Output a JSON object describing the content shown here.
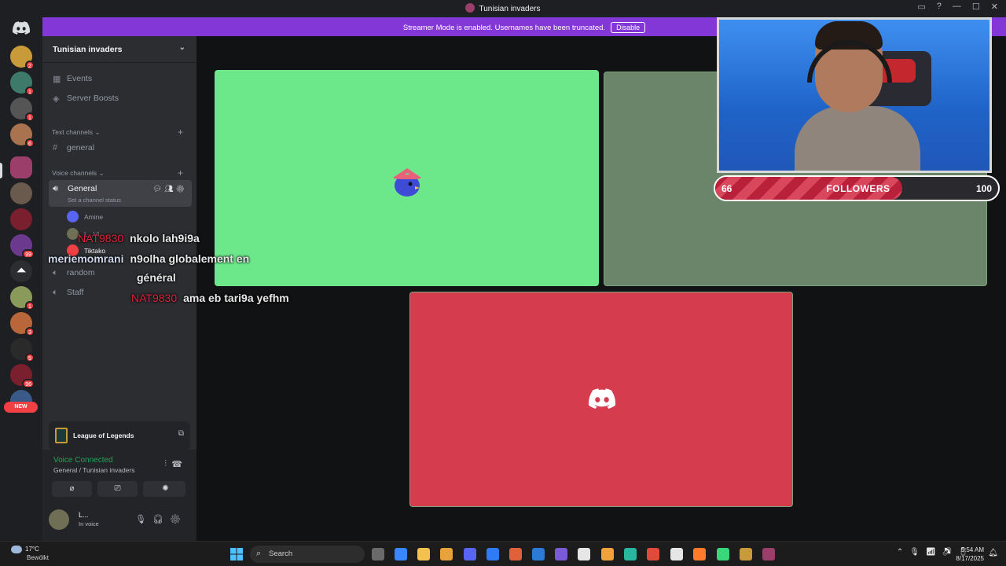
{
  "window": {
    "title": "Tunisian invaders",
    "controls": [
      "▭",
      "?",
      "—",
      "☐",
      "✕"
    ]
  },
  "banner": {
    "message": "Streamer Mode is enabled. Usernames have been truncated.",
    "button": "Disable"
  },
  "rail": {
    "new_label": "NEW",
    "badges": [
      "2",
      "1",
      "1",
      "6",
      "1",
      "99",
      "1",
      "3",
      "5",
      "96"
    ]
  },
  "server": {
    "name": "Tunisian invaders",
    "items": [
      {
        "icon": "calendar-icon",
        "label": "Events"
      },
      {
        "icon": "boost-icon",
        "label": "Server Boosts"
      }
    ],
    "text_category": "Text channels",
    "text_channels": [
      "general"
    ],
    "voice_category": "Voice channels",
    "voice_channel": {
      "name": "General",
      "status_placeholder": "Set a channel status"
    },
    "members": [
      "Amine",
      "L...Vi",
      "Tiktako"
    ],
    "other_voice": [
      "random",
      "Staff"
    ]
  },
  "chat_overlay": [
    {
      "user": "NAT9830",
      "text": "nkolo lah9i9a"
    },
    {
      "user": "meriemomrani",
      "text": "n9olha globalement en",
      "text2": "général"
    },
    {
      "user": "NAT9830",
      "text": "ama eb tari9a yefhm"
    }
  ],
  "activity": {
    "game": "League of Legends"
  },
  "voice_status": {
    "state": "Voice Connected",
    "location": "General / Tunisian invaders"
  },
  "user_panel": {
    "name": "L...",
    "status": "In voice"
  },
  "followers": {
    "current": "66",
    "label": "FOLLOWERS",
    "goal": "100",
    "progress": 0.66
  },
  "taskbar": {
    "temperature": "17°C",
    "weather": "Bewölkt",
    "search_placeholder": "Search",
    "time": "5:54 AM",
    "date": "8/17/2025"
  },
  "colors": {
    "tile1": "#6ce88a",
    "tile2": "#6a856a",
    "tile3": "#d53d4e",
    "banner": "#8237d6"
  }
}
